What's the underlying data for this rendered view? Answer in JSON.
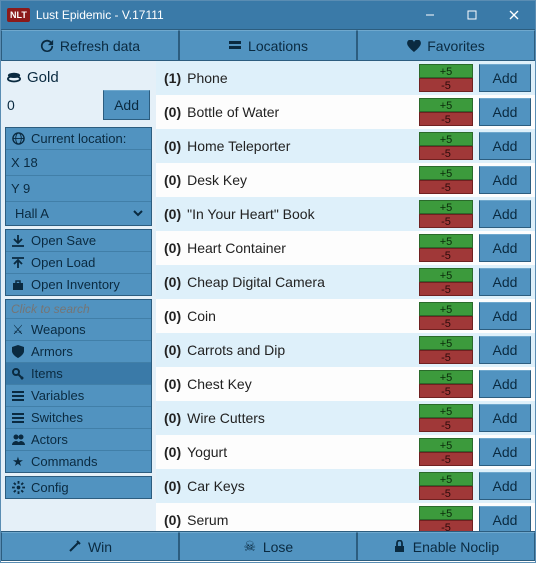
{
  "window": {
    "title": "Lust Epidemic - V.17111",
    "logo": "NLT"
  },
  "tabs": {
    "refresh": "Refresh data",
    "locations": "Locations",
    "favorites": "Favorites"
  },
  "gold": {
    "label": "Gold",
    "value": "0",
    "add": "Add"
  },
  "location": {
    "header": "Current location:",
    "x": "X 18",
    "y": "Y 9",
    "map": "Hall A"
  },
  "filebtns": {
    "save": "Open Save",
    "load": "Open Load",
    "inv": "Open Inventory"
  },
  "search": {
    "placeholder": "Click to search"
  },
  "cats": {
    "weapons": "Weapons",
    "armors": "Armors",
    "items": "Items",
    "variables": "Variables",
    "switches": "Switches",
    "actors": "Actors",
    "commands": "Commands"
  },
  "config": "Config",
  "item_add": "Add",
  "pm": {
    "plus": "+5",
    "minus": "-5"
  },
  "items": [
    {
      "qty": "(1)",
      "name": "Phone"
    },
    {
      "qty": "(0)",
      "name": "Bottle of Water"
    },
    {
      "qty": "(0)",
      "name": "Home Teleporter"
    },
    {
      "qty": "(0)",
      "name": "Desk Key"
    },
    {
      "qty": "(0)",
      "name": "\"In Your Heart\" Book"
    },
    {
      "qty": "(0)",
      "name": "Heart Container"
    },
    {
      "qty": "(0)",
      "name": "Cheap Digital Camera"
    },
    {
      "qty": "(0)",
      "name": "Coin"
    },
    {
      "qty": "(0)",
      "name": "Carrots and Dip"
    },
    {
      "qty": "(0)",
      "name": "Chest Key"
    },
    {
      "qty": "(0)",
      "name": "Wire Cutters"
    },
    {
      "qty": "(0)",
      "name": "Yogurt"
    },
    {
      "qty": "(0)",
      "name": "Car Keys"
    },
    {
      "qty": "(0)",
      "name": "Serum"
    }
  ],
  "footer": {
    "win": "Win",
    "lose": "Lose",
    "noclip": "Enable Noclip"
  }
}
